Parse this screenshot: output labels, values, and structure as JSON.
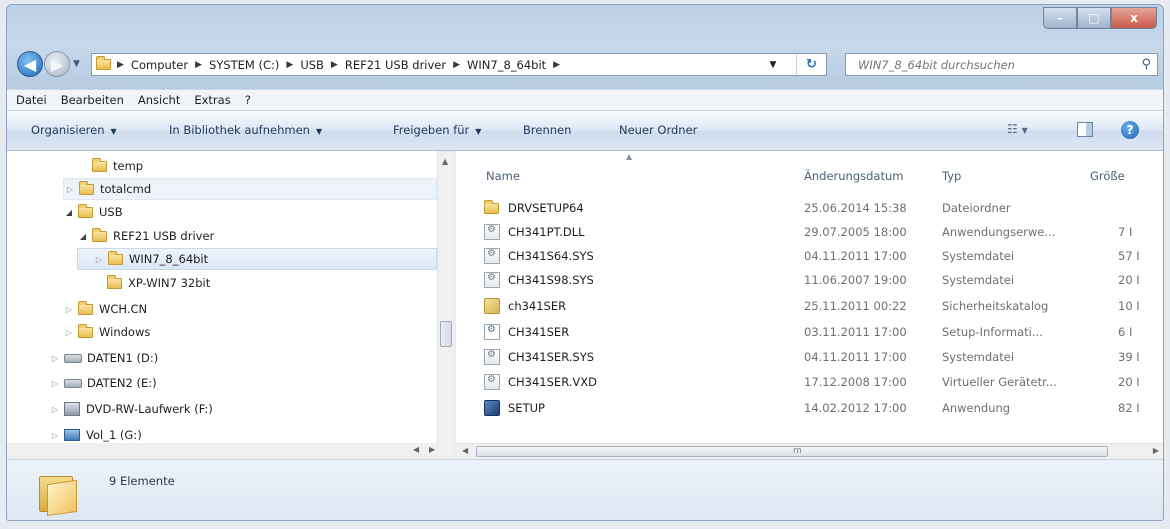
{
  "window": {
    "caption_buttons": {
      "minimize": "–",
      "maximize": "□",
      "close": "x"
    }
  },
  "nav": {
    "back_glyph": "◀",
    "forward_glyph": "▶",
    "breadcrumb": [
      "Computer",
      "SYSTEM (C:)",
      "USB",
      "REF21 USB driver",
      "WIN7_8_64bit"
    ],
    "search_placeholder": "WIN7_8_64bit durchsuchen"
  },
  "menubar": [
    "Datei",
    "Bearbeiten",
    "Ansicht",
    "Extras",
    "?"
  ],
  "toolbar": {
    "organize": "Organisieren",
    "library": "In Bibliothek aufnehmen",
    "share": "Freigeben für",
    "burn": "Brennen",
    "new_folder": "Neuer Ordner"
  },
  "tree": [
    {
      "label": "temp",
      "icon": "folder"
    },
    {
      "label": "totalcmd",
      "icon": "folder"
    },
    {
      "label": "USB",
      "icon": "folder"
    },
    {
      "label": "REF21 USB driver",
      "icon": "folder"
    },
    {
      "label": "WIN7_8_64bit",
      "icon": "folder",
      "selected": true
    },
    {
      "label": "XP-WIN7 32bit",
      "icon": "folder"
    },
    {
      "label": "WCH.CN",
      "icon": "folder"
    },
    {
      "label": "Windows",
      "icon": "folder"
    },
    {
      "label": "DATEN1 (D:)",
      "icon": "drive"
    },
    {
      "label": "DATEN2 (E:)",
      "icon": "drive"
    },
    {
      "label": "DVD-RW-Laufwerk (F:)",
      "icon": "dvd-drive"
    },
    {
      "label": "Vol_1 (G:)",
      "icon": "network-drive"
    }
  ],
  "columns": {
    "name": "Name",
    "date": "Änderungsdatum",
    "type": "Typ",
    "size": "Größe"
  },
  "files": [
    {
      "name": "DRVSETUP64",
      "date": "25.06.2014 15:38",
      "type": "Dateiordner",
      "size": "",
      "icon": "folder"
    },
    {
      "name": "CH341PT.DLL",
      "date": "29.07.2005 18:00",
      "type": "Anwendungserwe...",
      "size": "7 I",
      "icon": "dll"
    },
    {
      "name": "CH341S64.SYS",
      "date": "04.11.2011 17:00",
      "type": "Systemdatei",
      "size": "57 I",
      "icon": "sys"
    },
    {
      "name": "CH341S98.SYS",
      "date": "11.06.2007 19:00",
      "type": "Systemdatei",
      "size": "20 I",
      "icon": "sys"
    },
    {
      "name": "ch341SER",
      "date": "25.11.2011 00:22",
      "type": "Sicherheitskatalog",
      "size": "10 I",
      "icon": "catalog"
    },
    {
      "name": "CH341SER",
      "date": "03.11.2011 17:00",
      "type": "Setup-Informati...",
      "size": "6 I",
      "icon": "inf"
    },
    {
      "name": "CH341SER.SYS",
      "date": "04.11.2011 17:00",
      "type": "Systemdatei",
      "size": "39 I",
      "icon": "sys"
    },
    {
      "name": "CH341SER.VXD",
      "date": "17.12.2008 17:00",
      "type": "Virtueller Gerätetr...",
      "size": "20 I",
      "icon": "vxd"
    },
    {
      "name": "SETUP",
      "date": "14.02.2012 17:00",
      "type": "Anwendung",
      "size": "82 I",
      "icon": "exe"
    }
  ],
  "hscroll_grip": "m",
  "status": {
    "count": "9 Elemente"
  }
}
